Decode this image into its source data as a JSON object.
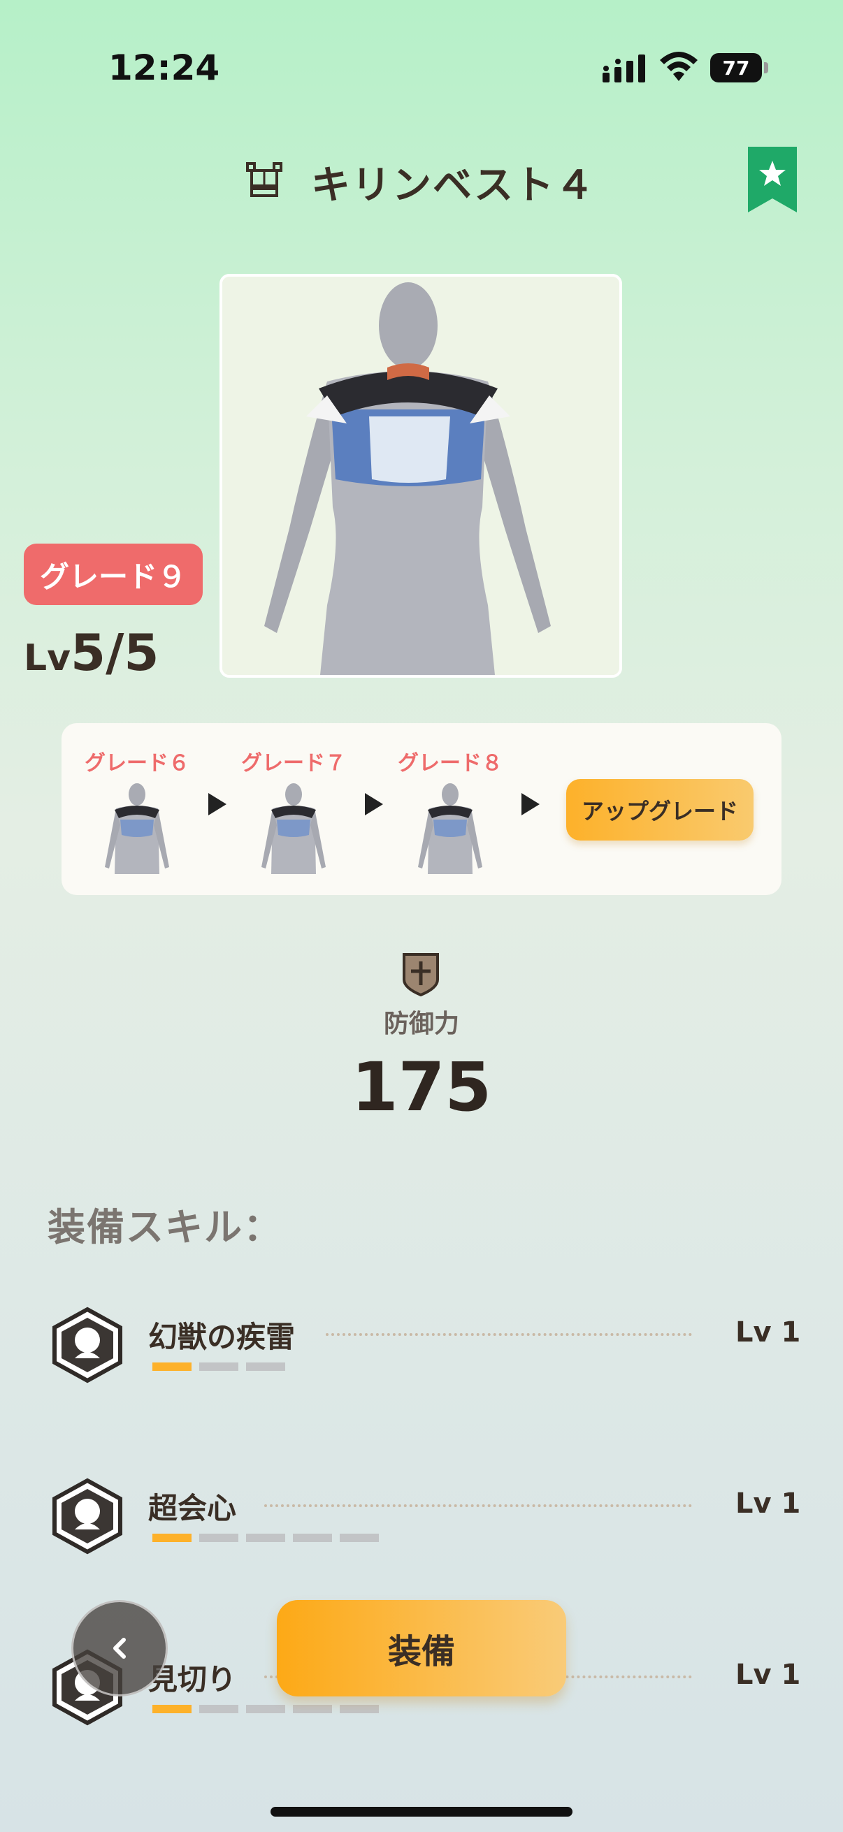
{
  "status_bar": {
    "time": "12:24",
    "battery": "77"
  },
  "header": {
    "title": "キリンベスト４",
    "icon": "armor-chest-icon",
    "bookmark_icon": "star-bookmark-icon"
  },
  "item": {
    "grade_badge": "グレード９",
    "level_prefix": "Lv",
    "level_value": "5/5"
  },
  "grade_progress": {
    "grades": [
      "グレード６",
      "グレード７",
      "グレード８"
    ],
    "upgrade_label": "アップグレード"
  },
  "defense": {
    "label": "防御力",
    "value": "175",
    "icon": "shield-icon"
  },
  "skills": {
    "title": "装備スキル：",
    "items": [
      {
        "name": "幻獣の疾雷",
        "level": "Lv 1",
        "current": 1,
        "max": 3
      },
      {
        "name": "超会心",
        "level": "Lv 1",
        "current": 1,
        "max": 5
      },
      {
        "name": "見切り",
        "level": "Lv 1",
        "current": 1,
        "max": 5
      }
    ]
  },
  "actions": {
    "equip_label": "装備",
    "back_icon": "chevron-left-icon"
  },
  "colors": {
    "accent": "#fdb12a",
    "grade_red": "#ef6b6b",
    "bookmark_green": "#1fa968"
  }
}
